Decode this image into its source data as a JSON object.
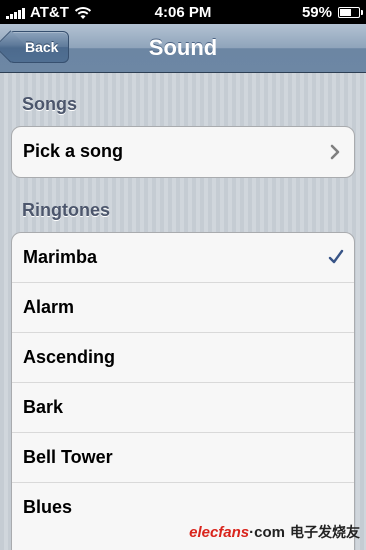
{
  "status_bar": {
    "carrier": "AT&T",
    "time": "4:06 PM",
    "battery_percent": "59%",
    "battery_level": 0.59,
    "icons": [
      "signal-icon",
      "wifi-icon",
      "battery-icon"
    ]
  },
  "nav": {
    "back_label": "Back",
    "title": "Sound"
  },
  "songs_section": {
    "header": "Songs",
    "items": [
      {
        "label": "Pick a song",
        "icon": "chevron-right-icon"
      }
    ]
  },
  "ringtones_section": {
    "header": "Ringtones",
    "selected": "Marimba",
    "items": [
      {
        "label": "Marimba",
        "checked": true
      },
      {
        "label": "Alarm"
      },
      {
        "label": "Ascending"
      },
      {
        "label": "Bark"
      },
      {
        "label": "Bell Tower"
      },
      {
        "label": "Blues"
      }
    ]
  },
  "watermark": {
    "brand": "elecfans",
    "dotcom": "·com",
    "chinese": "电子发烧友"
  },
  "colors": {
    "nav_bar": "#6d87a4",
    "background": "#cbd2d8",
    "section_header": "#4c566c",
    "checkmark": "#385487"
  }
}
